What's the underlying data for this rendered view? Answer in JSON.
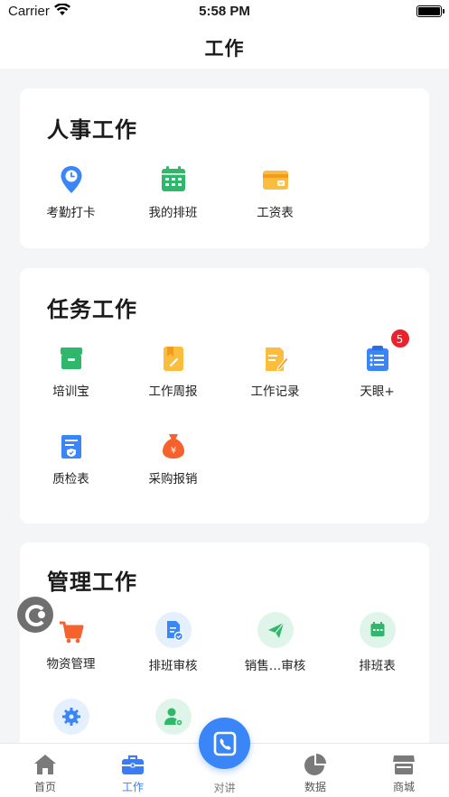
{
  "status_bar": {
    "carrier": "Carrier",
    "time": "5:58 PM"
  },
  "nav": {
    "title": "工作"
  },
  "hr_section": {
    "title": "人事工作",
    "items": [
      {
        "label": "考勤打卡",
        "icon": "location-clock-icon"
      },
      {
        "label": "我的排班",
        "icon": "calendar-icon"
      },
      {
        "label": "工资表",
        "icon": "wallet-card-icon"
      }
    ]
  },
  "task_section": {
    "title": "任务工作",
    "items": [
      {
        "label": "培训宝",
        "icon": "training-box-icon"
      },
      {
        "label": "工作周报",
        "icon": "weekly-report-icon"
      },
      {
        "label": "工作记录",
        "icon": "work-record-icon"
      },
      {
        "label": "天眼+",
        "icon": "sky-eye-list-icon",
        "badge": "5"
      },
      {
        "label": "质检表",
        "icon": "quality-check-icon"
      },
      {
        "label": "采购报销",
        "icon": "purchase-money-bag-icon"
      }
    ]
  },
  "mgmt_section": {
    "title": "管理工作",
    "items": [
      {
        "label": "物资管理",
        "icon": "cart-icon"
      },
      {
        "label": "排班审核",
        "icon": "schedule-review-icon"
      },
      {
        "label": "销售…审核",
        "icon": "send-plane-icon"
      },
      {
        "label": "排班表",
        "icon": "schedule-table-icon"
      },
      {
        "label": "",
        "icon": "settings-gear-icon"
      },
      {
        "label": "",
        "icon": "user-settings-icon"
      }
    ]
  },
  "tab_bar": {
    "items": [
      {
        "label": "首页",
        "icon": "home-icon"
      },
      {
        "label": "工作",
        "icon": "briefcase-icon",
        "active": true
      },
      {
        "label": "对讲",
        "icon": "intercom-phone-icon"
      },
      {
        "label": "数据",
        "icon": "pie-chart-icon"
      },
      {
        "label": "商城",
        "icon": "store-icon"
      }
    ]
  },
  "colors": {
    "accent": "#3a86f8",
    "badge": "#e8232e",
    "green": "#2fb86b",
    "yellow": "#fbbd3d",
    "orange": "#f5622e"
  }
}
